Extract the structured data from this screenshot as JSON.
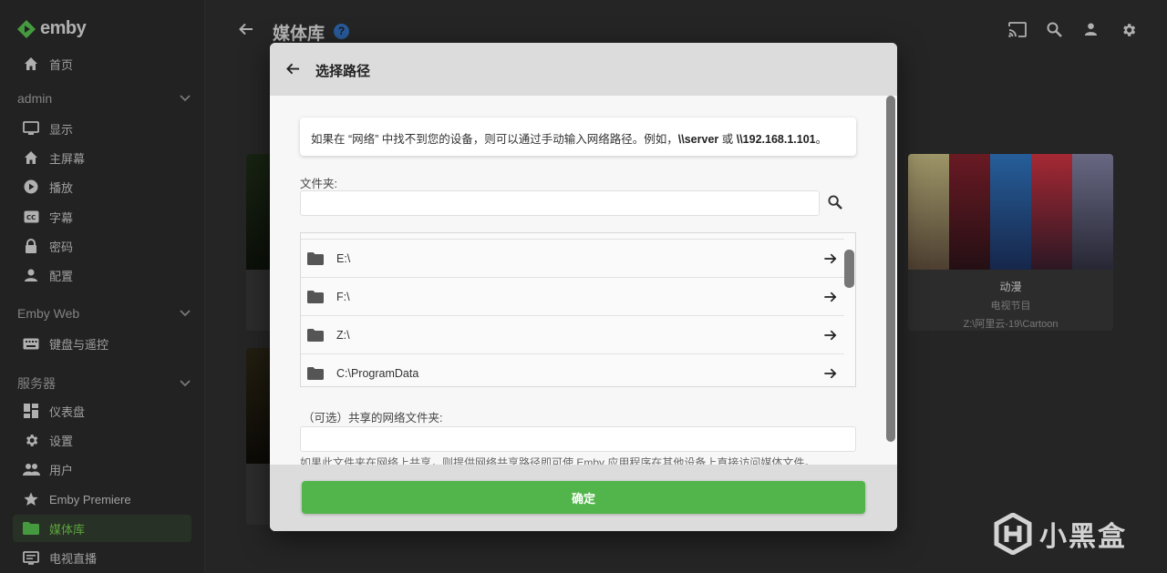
{
  "app": {
    "logo_text": "emby",
    "accent": "#52b54b"
  },
  "sidebar": {
    "home": "首页",
    "section_user": "admin",
    "user_items": [
      "显示",
      "主屏幕",
      "播放",
      "字幕",
      "密码",
      "配置"
    ],
    "section_web": "Emby Web",
    "web_items": [
      "键盘与遥控"
    ],
    "section_server": "服务器",
    "server_items": [
      "仪表盘",
      "设置",
      "用户",
      "Emby Premiere",
      "媒体库",
      "电视直播"
    ],
    "active_item": "媒体库"
  },
  "header": {
    "title": "媒体库",
    "help": "?"
  },
  "library_card": {
    "title": "动漫",
    "type": "电视节目",
    "path": "Z:\\阿里云-19\\Cartoon"
  },
  "dialog": {
    "title": "选择路径",
    "note_prefix": "如果在 “网络” 中找不到您的设备，则可以通过手动输入网络路径。例如，",
    "note_ex1": "\\\\server",
    "note_or": " 或 ",
    "note_ex2": "\\\\192.168.1.101",
    "note_suffix": "。",
    "folder_label": "文件夹:",
    "folder_value": "",
    "paths": [
      "E:\\",
      "F:\\",
      "Z:\\",
      "C:\\ProgramData"
    ],
    "share_label": "（可选）共享的网络文件夹:",
    "share_value": "",
    "share_hint": "如果此文件夹在网络上共享，则提供网络共享路径即可使 Emby 应用程序在其他设备上直接访问媒体文件。",
    "ok": "确定"
  },
  "watermark": "小黑盒"
}
